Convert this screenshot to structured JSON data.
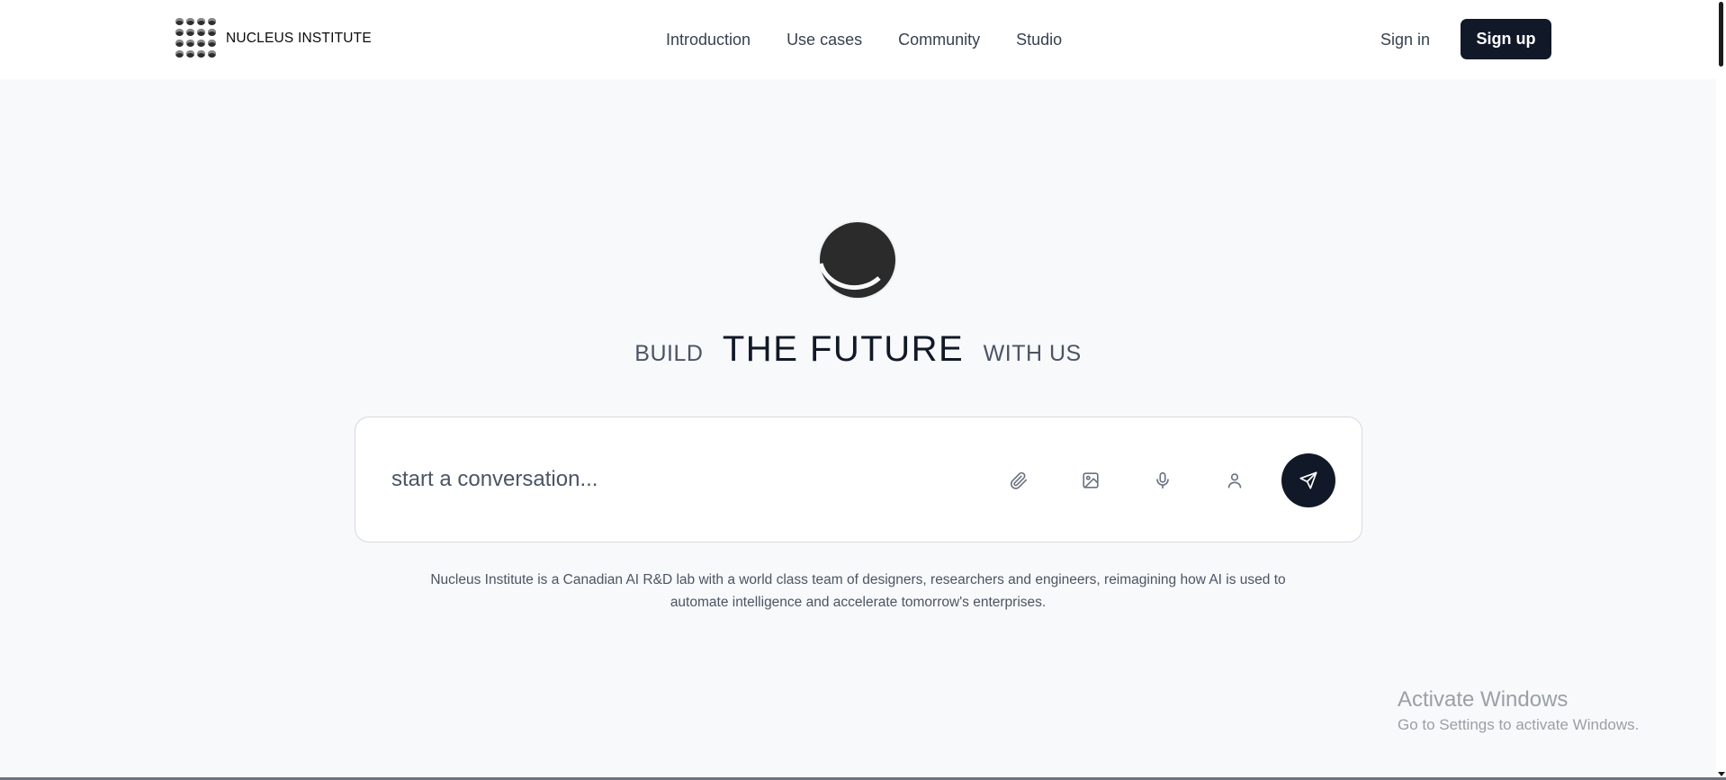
{
  "brand": {
    "name": "NUCLEUS INSTITUTE",
    "logo_icon": "dotted-grid-logo-icon"
  },
  "nav": {
    "items": [
      {
        "label": "Introduction"
      },
      {
        "label": "Use cases"
      },
      {
        "label": "Community"
      },
      {
        "label": "Studio"
      }
    ]
  },
  "auth": {
    "sign_in": "Sign in",
    "sign_up": "Sign up"
  },
  "hero": {
    "emblem_icon": "crescent-moon-icon",
    "headline_left": "BUILD",
    "headline_main": "THE FUTURE",
    "headline_right": "WITH US"
  },
  "chat": {
    "placeholder": "start a conversation...",
    "tools": [
      "paperclip-icon",
      "image-icon",
      "microphone-icon",
      "user-icon"
    ],
    "send_icon": "send-icon"
  },
  "description": {
    "line1": "Nucleus Institute is a Canadian AI R&D lab with a world class team of designers, researchers and engineers, reimagining how AI is used to",
    "line2": "automate intelligence and accelerate tomorrow's enterprises."
  },
  "watermark": {
    "title": "Activate Windows",
    "subtitle": "Go to Settings to activate Windows."
  },
  "colors": {
    "background": "#f8f9fb",
    "header_bg": "#ffffff",
    "primary_dark": "#111827",
    "text_muted": "#4b5563"
  }
}
